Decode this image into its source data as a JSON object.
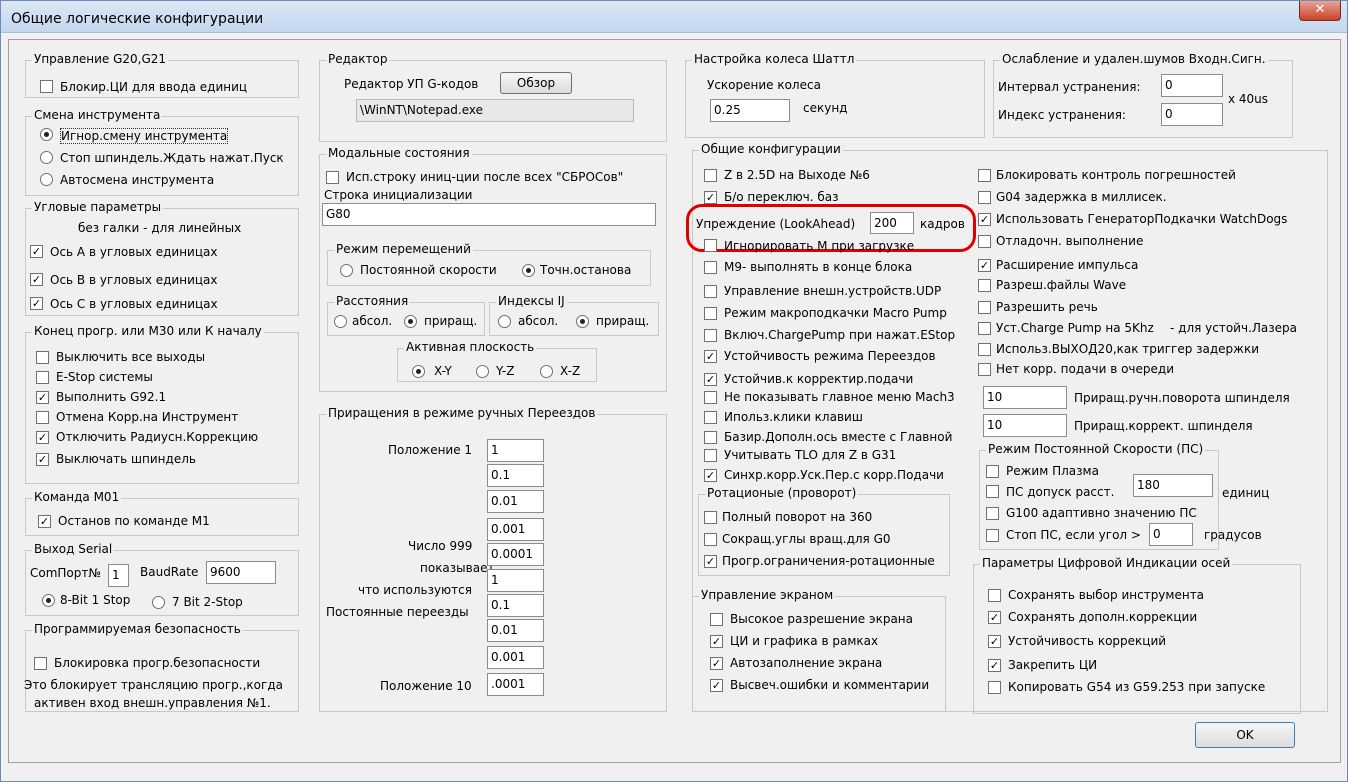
{
  "window": {
    "title": "Общие логические конфигурации",
    "close": "✕"
  },
  "units": {
    "title": "Управление G20,G21",
    "lock": "Блокир.ЦИ для ввода единиц"
  },
  "toolchange": {
    "title": "Смена инструмента",
    "opt1": "Игнор.смену инструмента",
    "opt2": "Стоп шпиндель.Ждать нажат.Пуск",
    "opt3": "Автосмена инструмента"
  },
  "angular": {
    "title": "Угловые параметры",
    "note": "без галки - для линейных",
    "a": "Ось А в угловых единицах",
    "b": "Ось В в угловых единицах",
    "c": "Ось С в угловых единицах"
  },
  "end": {
    "title": "Конец прогр. или M30 или К началу",
    "i1": "Выключить все выходы",
    "i2": "E-Stop системы",
    "i3": "Выполнить G92.1",
    "i4": "Отмена Корр.на Инструмент",
    "i5": "Отключить Радиусн.Коррекцию",
    "i6": "Выключать шпиндель"
  },
  "m01": {
    "title": "Команда М01",
    "stop": "Останов по команде М1"
  },
  "serial": {
    "title": "Выход Serial",
    "port_label": "ComПорт№",
    "port": "1",
    "baud_label": "BaudRate",
    "baud": "9600",
    "opt1": "8-Bit 1 Stop",
    "opt2": "7 Bit 2-Stop"
  },
  "safety": {
    "title": "Программируемая безопасность",
    "lock": "Блокировка прогр.безопасности",
    "note1": "Это блокирует трансляцию прогр.,когда",
    "note2": "активен вход внешн.управления №1."
  },
  "editor": {
    "title": "Редактор",
    "label": "Редактор УП G-кодов",
    "browse": "Обзор",
    "path": "\\WinNT\\Notepad.exe"
  },
  "modal": {
    "title": "Модальные состояния",
    "reset": "Исп.строку иниц-ции после всех \"СБРОСов\"",
    "init_label": "Строка инициализации",
    "init": "G80",
    "motion_title": "Режим перемещений",
    "cv": "Постоянной скорости",
    "es": "Точн.останова",
    "dist_title": "Расстояния",
    "ij_title": "Индексы IJ",
    "abs": "абсол.",
    "inc": "приращ.",
    "plane_title": "Активная плоскость",
    "xy": "X-Y",
    "yz": "Y-Z",
    "xz": "X-Z"
  },
  "jog": {
    "title": "Приращения в режиме ручных Переездов",
    "pos1": "Положение 1",
    "note1": "Число 999",
    "note2": "показывает,",
    "note3": "что используются",
    "note4": "Постоянные переезды",
    "pos10": "Положение 10",
    "values": [
      "1",
      "0.1",
      "0.01",
      "0.001",
      "0.0001",
      "1",
      "0.1",
      "0.01",
      "0.001",
      ".0001"
    ]
  },
  "shuttle": {
    "title": "Настройка колеса Шаттл",
    "accel": "Ускорение колеса",
    "value": "0.25",
    "unit": "секунд"
  },
  "debounce": {
    "title": "Ослабление и удален.шумов Входн.Сигн.",
    "interval": "Интервал устранения:",
    "interval_val": "0",
    "index": "Индекс устранения:",
    "index_val": "0",
    "unit": "x 40us"
  },
  "general": {
    "title": "Общие конфигурации",
    "z25": "Z в 2.5D на Выходе №6",
    "nosw": "Б/о переключ. баз",
    "lookahead_label": "Упреждение (LookAhead)",
    "lookahead": "200",
    "frames": "кадров",
    "ignm": "Игнорировать М при загрузке",
    "m9": "M9- выполнять в конце блока",
    "udp": "Управление внешн.устройств.UDP",
    "macro": "Режим макроподкачки Macro Pump",
    "charge": "Включ.ChargePump при нажат.EStop",
    "persist": "Устойчивость режима Переездов",
    "feedov": "Устойчив.к корректир.подачи",
    "nomenu": "Не показывать главное меню Mach3",
    "keyclicks": "Ипольз.клики клавиш",
    "home": "Базир.Дополн.ось вместе с Главной",
    "tlo": "Учитывать TLO для Z в G31",
    "sync": "Синхр.корр.Уск.Пер.с корр.Подачи",
    "lockerr": "Блокировать контроль погрешностей",
    "g04": "G04 задержка в миллисек.",
    "watchdog": "Использовать ГенераторПодкачки WatchDogs",
    "debug": "Отладочн. выполнение",
    "pulse": "Расширение импульса",
    "wave": "Разреш.файлы Wave",
    "speech": "Разрешить речь",
    "cp5": "Уст.Charge Pump на 5Khz",
    "laser": "- для устойч.Лазера",
    "out20": "Использ.ВЫХОД20,как триггер задержки",
    "noqueue": "Нет корр. подачи в очереди",
    "spin_rot_val": "10",
    "spin_rot": "Приращ.ручн.поворота шпинделя",
    "spin_ov_val": "10",
    "spin_ov": "Приращ.коррект. шпинделя"
  },
  "rotary": {
    "title": "Ротационые (проворот)",
    "full": "Полный поворот на 360",
    "short": "Сокращ.углы вращ.для G0",
    "soft": "Прогр.ограничения-ротационные"
  },
  "screen": {
    "title": "Управление экраном",
    "hires": "Высокое разрешение экрана",
    "frames": "ЦИ и графика в рамках",
    "autofill": "Автозаполнение экрана",
    "errors": "Высвеч.ошибки и комментарии"
  },
  "cs": {
    "title": "Режим Постоянной Скорости (ПС)",
    "plasma": "Режим Плазма",
    "allow": "ПС допуск расст.",
    "allow_val": "180",
    "units": "единиц",
    "g100": "G100 адаптивно значению ПС",
    "stop": "Стоп ПС, если угол >",
    "stop_val": "0",
    "deg": "градусов"
  },
  "dro": {
    "title": "Параметры Цифровой Индикации осей",
    "save_tool": "Сохранять выбор инструмента",
    "save_fix": "Сохранять дополн.коррекции",
    "persist": "Устойчивость коррекций",
    "lock": "Закрепить ЦИ",
    "copy": "Копировать G54 из G59.253 при запуске"
  },
  "ok": "OK",
  "colors": {
    "highlight": "#e00000"
  }
}
